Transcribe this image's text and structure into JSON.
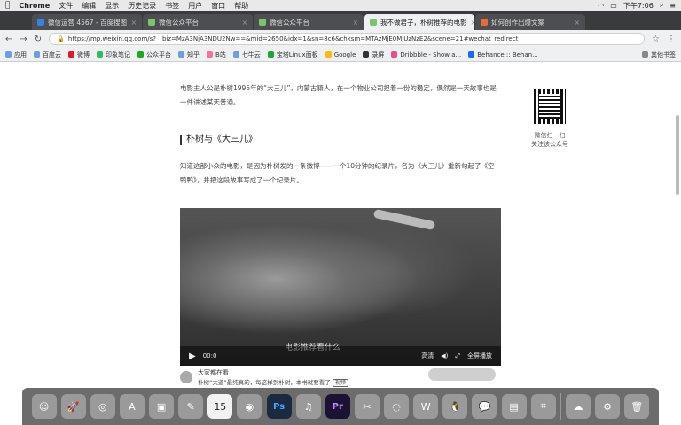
{
  "menubar": {
    "app": "Chrome",
    "items": [
      "文件",
      "编辑",
      "显示",
      "历史记录",
      "书签",
      "用户",
      "窗口",
      "帮助"
    ],
    "clock": "下午7:06"
  },
  "tabs": [
    {
      "title": "微信运营 4567 - 百度搜图",
      "active": false
    },
    {
      "title": "微信公众平台",
      "active": false
    },
    {
      "title": "微信公众平台",
      "active": false
    },
    {
      "title": "我不做君子，朴树推荐的电影",
      "active": true
    },
    {
      "title": "如何创作出爆文案",
      "active": false
    }
  ],
  "address": {
    "url": "https://mp.weixin.qq.com/s?__biz=MzA3NjA3NDU2Nw==&mid=2650&idx=1&sn=8c6&chksm=MTAzMjE0MjUzNzE2&scene=21#wechat_redirect"
  },
  "bookmarks": {
    "items": [
      "应用",
      "百度云",
      "微博",
      "印象笔记",
      "公众平台",
      "知乎",
      "B站",
      "七牛云",
      "宝塔Linux面板",
      "Google",
      "录屏",
      "Dribbble - Show a...",
      "Behance :: Behan..."
    ],
    "more": "其他书签"
  },
  "article": {
    "para1": "电影主人公是朴树1995年的“大三儿”，内蒙古籍人，在一个物业公司担着一份的稳定，偶然是一天故事也是一件讲述某天普通。",
    "section_title": "朴树与《大三儿》",
    "para2": "知道这部小众的电影，是因为朴树发的一条微博——一个10分钟的纪录片，名为《大三儿》重新勾起了《空鸭鸭》，并把这段故事写成了一个纪录片。"
  },
  "video": {
    "time": "00:0",
    "subtitle": "电影推荐看什么",
    "quality": "高清",
    "fullscreen": "全屏播放"
  },
  "sidebar": {
    "qr_caption_1": "微信扫一扫",
    "qr_caption_2": "关注该公众号"
  },
  "bottom": {
    "label": "大家都在看",
    "subtext": "朴树“大道”最纯真的，每这样到朴树，本书就要看了",
    "badge": "视频"
  },
  "dock": {
    "items": [
      "finder-icon",
      "launchpad-icon",
      "safari-icon",
      "appstore-icon",
      "preview-icon",
      "notes-icon",
      "calendar-icon",
      "chrome-icon",
      "photoshop-icon",
      "qq-music-icon",
      "premiere-icon",
      "finalcut-icon",
      "vpn-icon",
      "wps-icon",
      "qq-icon",
      "wechat-icon",
      "notes2-icon",
      "screenshot-icon",
      "baidu-netdisk-icon",
      "settings-icon",
      "trash-icon"
    ],
    "calendar_day": "15"
  }
}
